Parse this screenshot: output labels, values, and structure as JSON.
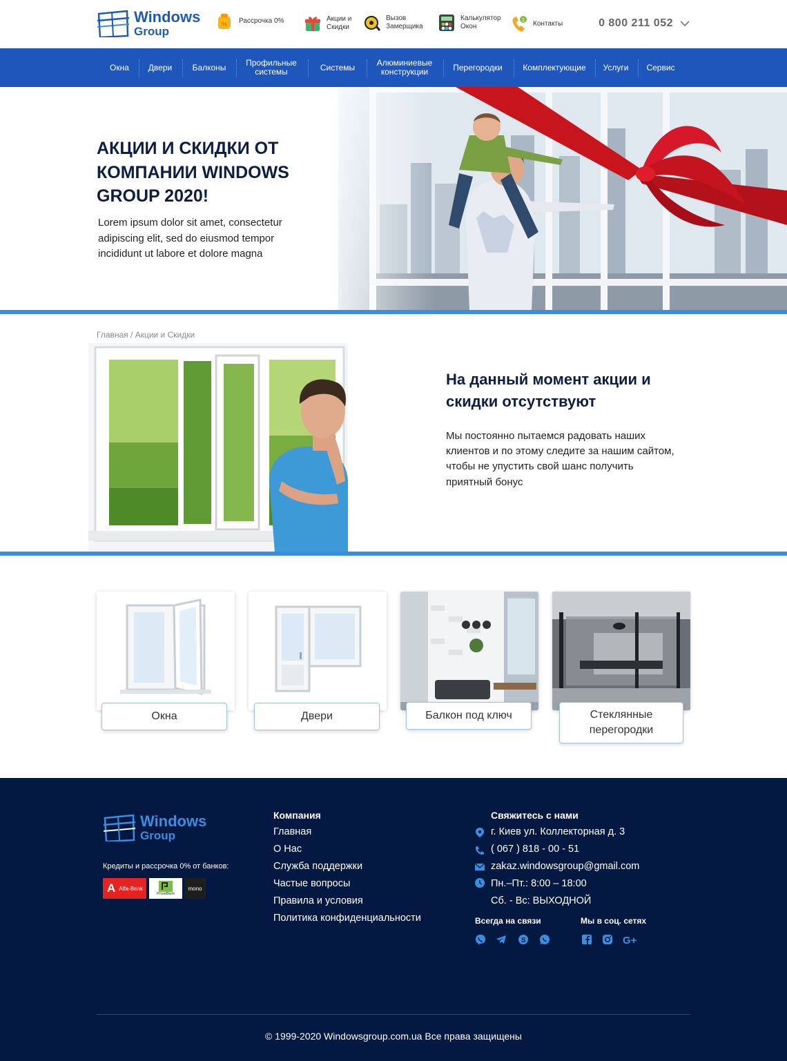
{
  "brand": {
    "name_line1": "Windows",
    "name_line2": "Group"
  },
  "header": {
    "links": [
      {
        "label": "Рассрочка 0%",
        "icon": "wallet-percent-icon"
      },
      {
        "label_line1": "Акции и",
        "label_line2": "Скидки",
        "icon": "gift-icon"
      },
      {
        "label_line1": "Вызов",
        "label_line2": "Замерщика",
        "icon": "tape-measure-icon"
      },
      {
        "label_line1": "Калькулятор",
        "label_line2": "Окон",
        "icon": "calculator-icon"
      },
      {
        "label": "Контакты",
        "icon": "phone-icon"
      }
    ],
    "phone": "0 800 211 052"
  },
  "nav": {
    "items": [
      {
        "label": "Окна"
      },
      {
        "label": "Двери"
      },
      {
        "label": "Балконы"
      },
      {
        "label_line1": "Профильные",
        "label_line2": "системы"
      },
      {
        "label": "Системы"
      },
      {
        "label_line1": "Алюминиевые",
        "label_line2": "конструкции"
      },
      {
        "label": "Перегородки"
      },
      {
        "label": "Комплектующие"
      },
      {
        "label": "Услуги"
      },
      {
        "label": "Сервис"
      }
    ]
  },
  "hero": {
    "title": "АКЦИИ И СКИДКИ ОТ КОМПАНИИ WINDOWS GROUP 2020!",
    "text": "Lorem ipsum dolor sit amet, consectetur adipiscing elit, sed do eiusmod tempor incididunt ut labore et dolore magna"
  },
  "breadcrumb": {
    "home": "Главная /",
    "current": "Акции и Скидки"
  },
  "promo": {
    "heading": "На данный момент акции и скидки отсутствуют",
    "text": "Мы постоянно пытаемся радовать наших клиентов и по этому  следите за нашим сайтом, чтобы не упустить свой шанс получить приятный бонус"
  },
  "categories": [
    {
      "label": "Окна"
    },
    {
      "label": "Двери"
    },
    {
      "label": "Балкон под ключ"
    },
    {
      "label_line1": "Стеклянные",
      "label_line2": "перегородки"
    }
  ],
  "footer": {
    "brand_line1": "Windows",
    "brand_line2": "Group",
    "credit_text": "Кредиты и рассрочка  0% от банков:",
    "banks": [
      "Alfa-Bank",
      "PrivatBank",
      "mono"
    ],
    "company_heading": "Компания",
    "company_links": [
      "Главная",
      "О Нас",
      "Служба поддержки",
      "Частые вопросы",
      "Правила и условия",
      "Политика конфиденциальности"
    ],
    "contact_heading": "Свяжитесь с нами",
    "address": "г. Киев  ул. Коллекторная д. 3",
    "phone": "( 067 ) 818 - 00 - 51",
    "email": "zakaz.windowsgroup@gmail.com",
    "hours_weekdays": "Пн.–Пт.: 8:00 – 18:00",
    "hours_weekend": "Сб. - Вс: ВЫХОДНОЙ",
    "always_online": "Всегда на связи",
    "social_heading": "Мы в соц. сетях",
    "messengers": [
      "viber-icon",
      "telegram-icon",
      "skype-icon",
      "whatsapp-icon"
    ],
    "socials": [
      "facebook-icon",
      "instagram-icon",
      "google-plus-icon"
    ],
    "copyright": "© 1999-2020 Windowsgroup.com.ua Все права защищены"
  },
  "colors": {
    "nav_bg": "#1f56bb",
    "accent_line": "#3a8ddf",
    "footer_bg": "#041942",
    "heading": "#0c1e44",
    "brand_blue": "#1e5bb8"
  }
}
